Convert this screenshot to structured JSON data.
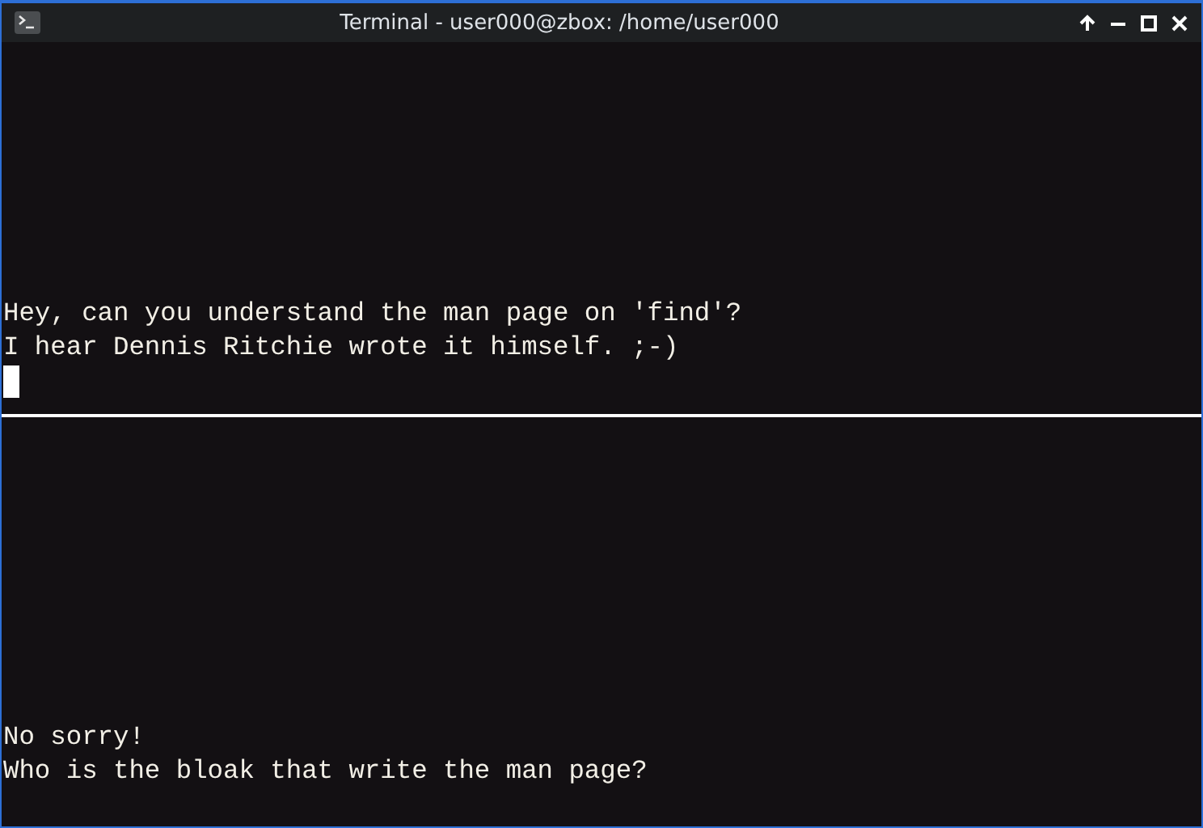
{
  "window": {
    "title": "Terminal - user000@zbox: /home/user000"
  },
  "panes": [
    {
      "lines": [
        "Hey, can you understand the man page on 'find'?",
        "I hear Dennis Ritchie wrote it himself. ;-)"
      ],
      "cursor": true
    },
    {
      "lines": [
        "No sorry!",
        "Who is the bloak that write the man page?"
      ],
      "cursor": false
    }
  ]
}
